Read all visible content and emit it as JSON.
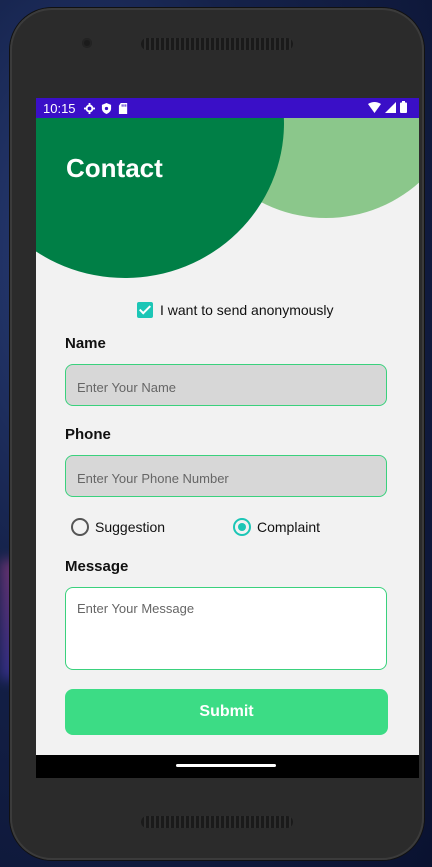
{
  "status_bar": {
    "time": "10:15"
  },
  "page": {
    "title": "Contact"
  },
  "form": {
    "anonymous_label": "I want to send anonymously",
    "anonymous_checked": true,
    "name_label": "Name",
    "name_placeholder": "Enter Your Name",
    "phone_label": "Phone",
    "phone_placeholder": "Enter Your Phone Number",
    "type_options": [
      {
        "label": "Suggestion",
        "selected": false
      },
      {
        "label": "Complaint",
        "selected": true
      }
    ],
    "message_label": "Message",
    "message_placeholder": "Enter Your Message",
    "submit_label": "Submit"
  },
  "colors": {
    "status_bar": "#3a0fc7",
    "header_dark": "#007f46",
    "header_light": "#8bc78b",
    "accent": "#1cc6b6",
    "submit": "#3cdc85",
    "field_border": "#3ad17d"
  },
  "icons": [
    "gear-icon",
    "shield-icon",
    "sd-card-icon",
    "wifi-icon",
    "signal-icon",
    "battery-icon"
  ]
}
